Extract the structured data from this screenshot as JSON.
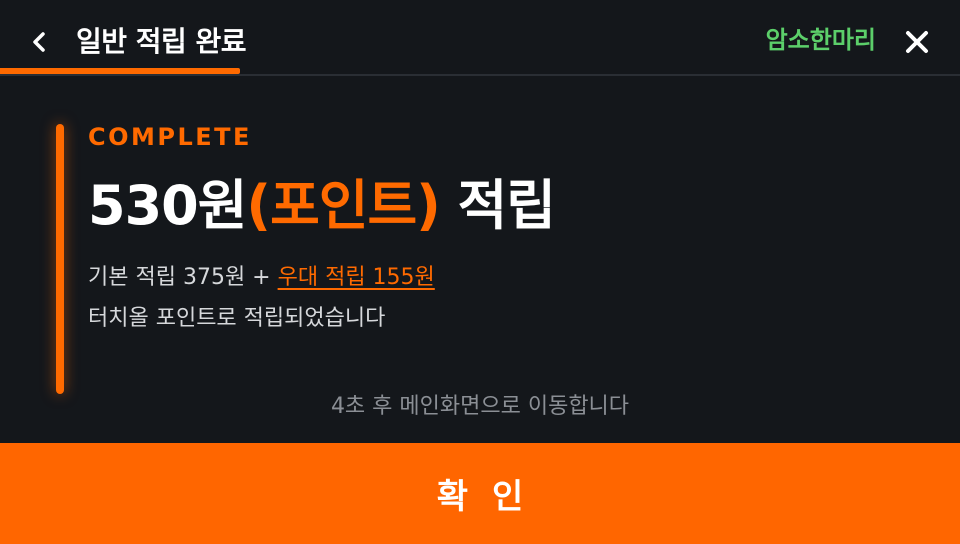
{
  "header": {
    "title": "일반 적립 완료",
    "store_name": "암소한마리",
    "progress_percent": 25
  },
  "result": {
    "status_label": "COMPLETE",
    "amount": "530원",
    "unit": "(포인트)",
    "action": "적립",
    "base_text": "기본 적립 375원 + ",
    "bonus_text": "우대 적립 155원",
    "message": "터치올 포인트로 적립되었습니다"
  },
  "countdown": "4초 후 메인화면으로 이동합니다",
  "confirm_label": "확인",
  "colors": {
    "accent": "#ff6a00",
    "store_name": "#5ccf6a",
    "background": "#14171b"
  },
  "icons": {
    "back": "chevron-left-icon",
    "close": "close-icon"
  }
}
